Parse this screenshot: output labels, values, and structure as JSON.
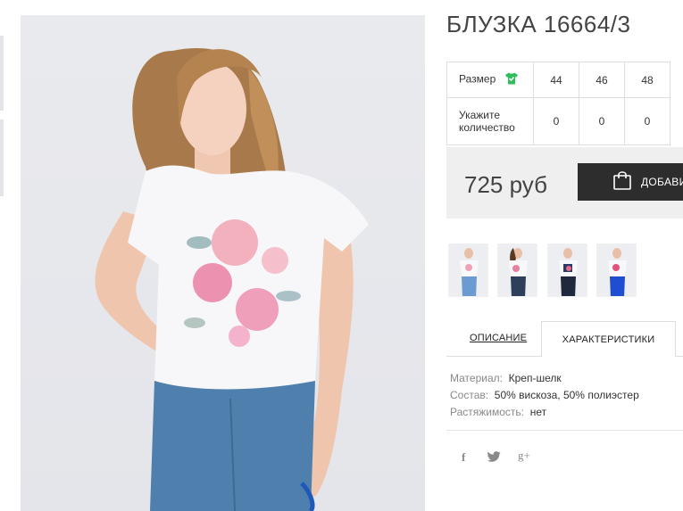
{
  "product": {
    "title": "БЛУЗКА 16664/3"
  },
  "sizes": {
    "size_label": "Размер",
    "qty_label_line1": "Укажите",
    "qty_label_line2": "количество",
    "options": [
      {
        "size": "44",
        "qty": "0"
      },
      {
        "size": "46",
        "qty": "0"
      },
      {
        "size": "48",
        "qty": "0"
      }
    ],
    "size_icon": "tshirt-icon",
    "size_icon_color": "#2dbd5a"
  },
  "purchase": {
    "price": "725 руб",
    "add_button_label": "ДОБАВИТЬ",
    "button_color": "#2d2d2d"
  },
  "tabs": {
    "description": "ОПИСАНИЕ",
    "characteristics": "ХАРАКТЕРИСТИКИ"
  },
  "characteristics": [
    {
      "key": "Материал:",
      "value": "Креп-шелк"
    },
    {
      "key": "Состав:",
      "value": "50% вискоза, 50% полиэстер"
    },
    {
      "key": "Растяжимость:",
      "value": "нет"
    }
  ],
  "social": {
    "facebook": "f",
    "twitter_icon": "twitter-icon",
    "googleplus": "g+"
  }
}
